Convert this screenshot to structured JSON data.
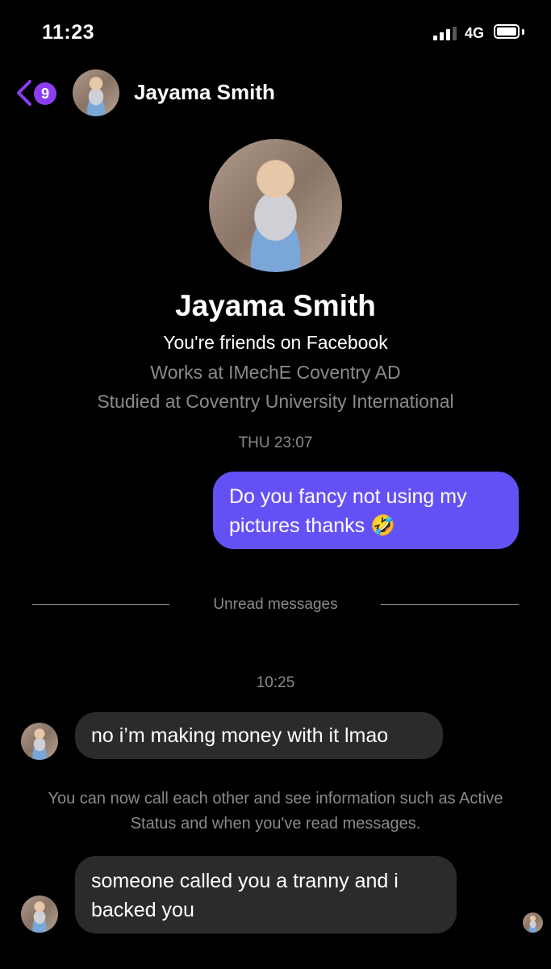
{
  "status_bar": {
    "time": "11:23",
    "network": "4G"
  },
  "header": {
    "unread_count": "9",
    "contact_name": "Jayama Smith"
  },
  "profile": {
    "name": "Jayama Smith",
    "friends_text": "You're friends on Facebook",
    "works": "Works at IMechE Coventry AD",
    "studied": "Studied at Coventry University International"
  },
  "thread": {
    "timestamp_1": "THU 23:07",
    "outgoing_1": "Do you fancy not using my pictures thanks 🤣",
    "unread_label": "Unread messages",
    "timestamp_2": "10:25",
    "incoming_1": "no i’m making money with it lmao",
    "notice": "You can now call each other and see information such as Active Status and when you've read messages.",
    "incoming_2": "someone called you a tranny and i backed you"
  },
  "colors": {
    "accent": "#8a3ef0",
    "outgoing_bubble": "#6351f5",
    "incoming_bubble": "#2b2b2d"
  }
}
